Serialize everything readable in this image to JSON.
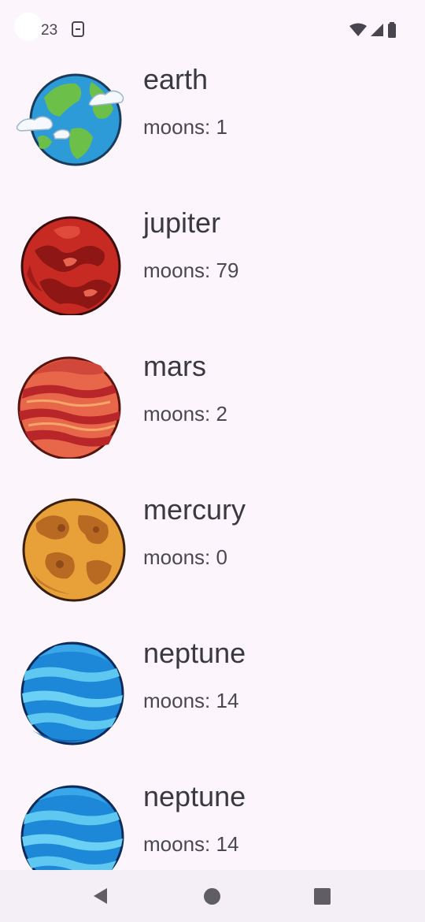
{
  "status_bar": {
    "time": "23",
    "icons": [
      "sim-card-icon",
      "wifi-icon",
      "cell-signal-icon",
      "battery-icon"
    ]
  },
  "planets": [
    {
      "name": "earth",
      "moons_label": "moons: 1",
      "icon": "earth-planet-icon"
    },
    {
      "name": "jupiter",
      "moons_label": "moons: 79",
      "icon": "jupiter-planet-icon"
    },
    {
      "name": "mars",
      "moons_label": "moons: 2",
      "icon": "mars-planet-icon"
    },
    {
      "name": "mercury",
      "moons_label": "moons: 0",
      "icon": "mercury-planet-icon"
    },
    {
      "name": "neptune",
      "moons_label": "moons: 14",
      "icon": "neptune-planet-icon"
    },
    {
      "name": "neptune",
      "moons_label": "moons: 14",
      "icon": "neptune-planet-icon"
    }
  ],
  "nav_bar": {
    "icons": [
      "back-icon",
      "home-icon",
      "recents-icon"
    ]
  },
  "colors": {
    "background": "#FCF6FC",
    "text": "#3A3840",
    "nav_background": "#F4EEF6"
  }
}
